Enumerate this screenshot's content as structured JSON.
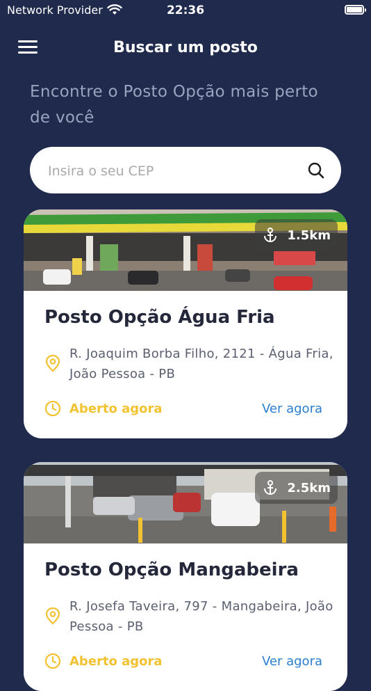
{
  "status_bar": {
    "provider": "Network Provider",
    "time": "22:36"
  },
  "header": {
    "title": "Buscar um posto"
  },
  "intro": {
    "text": "Encontre o Posto Opção mais perto de você"
  },
  "search": {
    "placeholder": "Insira o seu CEP"
  },
  "colors": {
    "background": "#1f2a4c",
    "accent_yellow": "#f2c230",
    "link_blue": "#2a7fd0"
  },
  "stations": [
    {
      "distance": "1.5km",
      "name": "Posto Opção Água Fria",
      "address": "R. Joaquim Borba Filho, 2121 - Água Fria, João Pessoa - PB",
      "status": "Aberto agora",
      "action": "Ver agora"
    },
    {
      "distance": "2.5km",
      "name": "Posto Opção Mangabeira",
      "address": "R. Josefa Taveira, 797 - Mangabeira, João Pessoa - PB",
      "status": "Aberto agora",
      "action": "Ver agora"
    }
  ]
}
